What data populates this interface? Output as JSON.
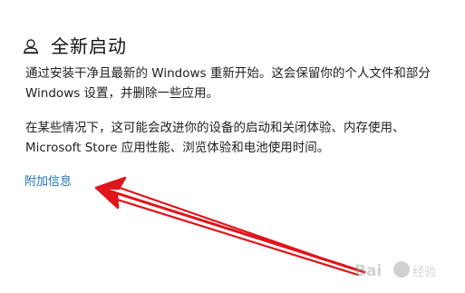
{
  "section": {
    "title": "全新启动",
    "icon": "fresh-start-icon"
  },
  "paragraphs": {
    "line1": "通过安装干净且最新的 Windows 重新开始。这会保留你的个人文件和部分",
    "line2": "Windows 设置，并删除一些应用。",
    "line3": "在某些情况下，这可能会改进你的设备的启动和关闭体验、内存使用、",
    "line4": "Microsoft Store 应用性能、浏览体验和电池使用时间。"
  },
  "link": {
    "label": "附加信息"
  },
  "colors": {
    "link": "#1f6fb5",
    "annotation_arrow": "#e0141a",
    "text": "#222222"
  }
}
